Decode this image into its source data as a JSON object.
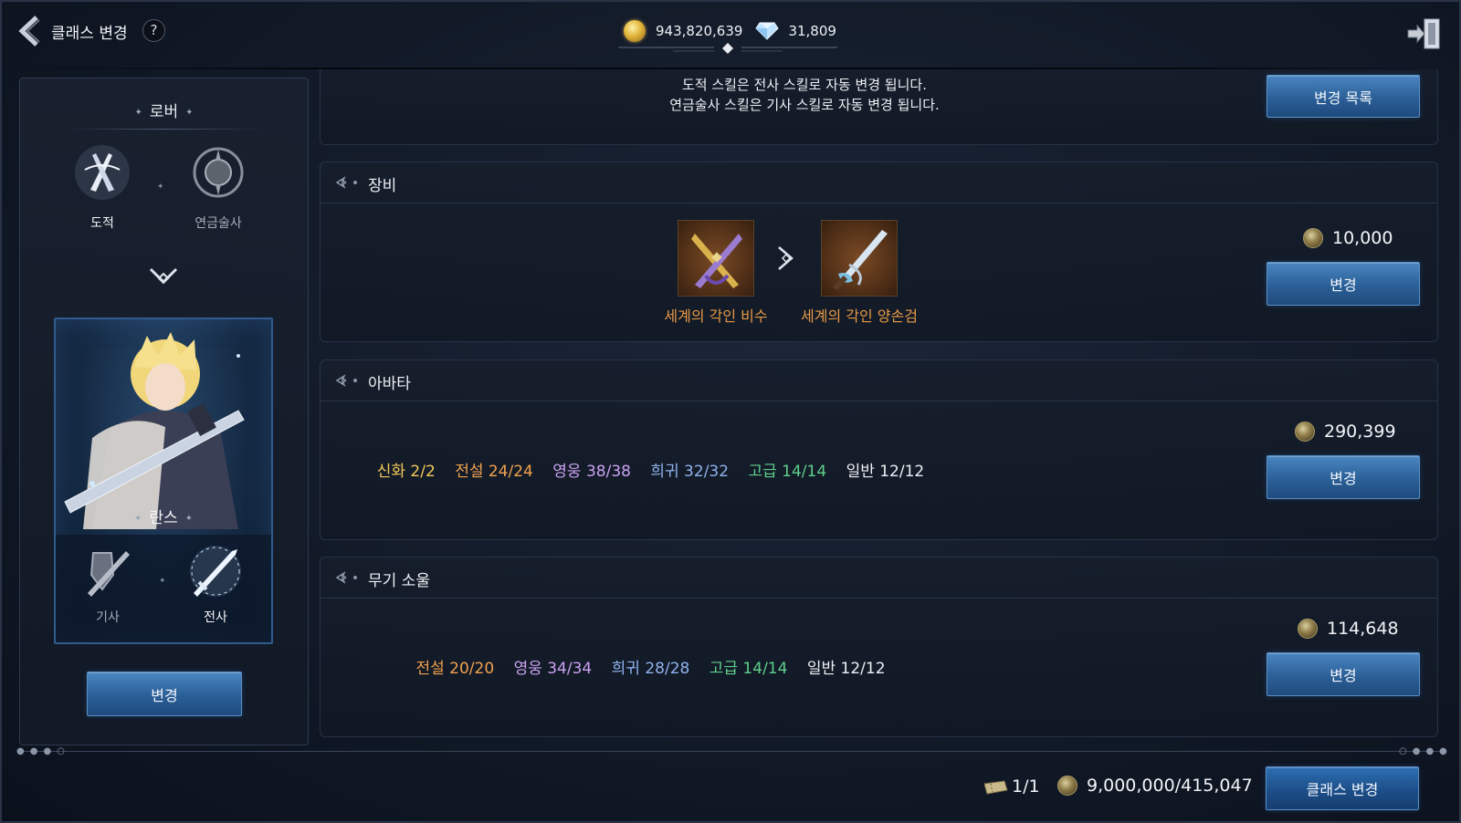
{
  "header": {
    "title": "클래스 변경",
    "help": "?",
    "gold": "943,820,639",
    "diamond": "31,809"
  },
  "left_panel": {
    "group_title": "로버",
    "from_classes": [
      {
        "label": "도적",
        "selected": true
      },
      {
        "label": "연금술사",
        "selected": false
      }
    ],
    "target_group": "란스",
    "to_classes": [
      {
        "label": "기사",
        "selected": false
      },
      {
        "label": "전사",
        "selected": true
      }
    ],
    "change_button": "변경"
  },
  "notice": {
    "line1": "도적 스킬은 전사 스킬로 자동 변경 됩니다.",
    "line2": "연금술사 스킬은 기사 스킬로 자동 변경 됩니다.",
    "list_button": "변경 목록"
  },
  "sections": {
    "equipment": {
      "title": "장비",
      "from_item": "세계의 각인 비수",
      "to_item": "세계의 각인 양손검",
      "cost": "10,000",
      "button": "변경"
    },
    "avatar": {
      "title": "아바타",
      "grades": [
        "신화 2/2",
        "전설 24/24",
        "영웅 38/38",
        "희귀 32/32",
        "고급 14/14",
        "일반 12/12"
      ],
      "cost": "290,399",
      "button": "변경"
    },
    "weapon_soul": {
      "title": "무기 소울",
      "grades": [
        "전설 20/20",
        "영웅 34/34",
        "희귀 28/28",
        "고급 14/14",
        "일반 12/12"
      ],
      "cost": "114,648",
      "button": "변경"
    }
  },
  "footer": {
    "ticket": "1/1",
    "total_cost": "9,000,000/415,047",
    "class_change_button": "클래스 변경"
  },
  "colors": {
    "myth": "#f2c85a",
    "legend": "#f0a24e",
    "hero": "#c9a2f0",
    "rare": "#8fb3ee",
    "advanced": "#5ecf8a",
    "normal": "#eef0f4",
    "button": "#2b5f97",
    "item_label": "#e79a45"
  }
}
